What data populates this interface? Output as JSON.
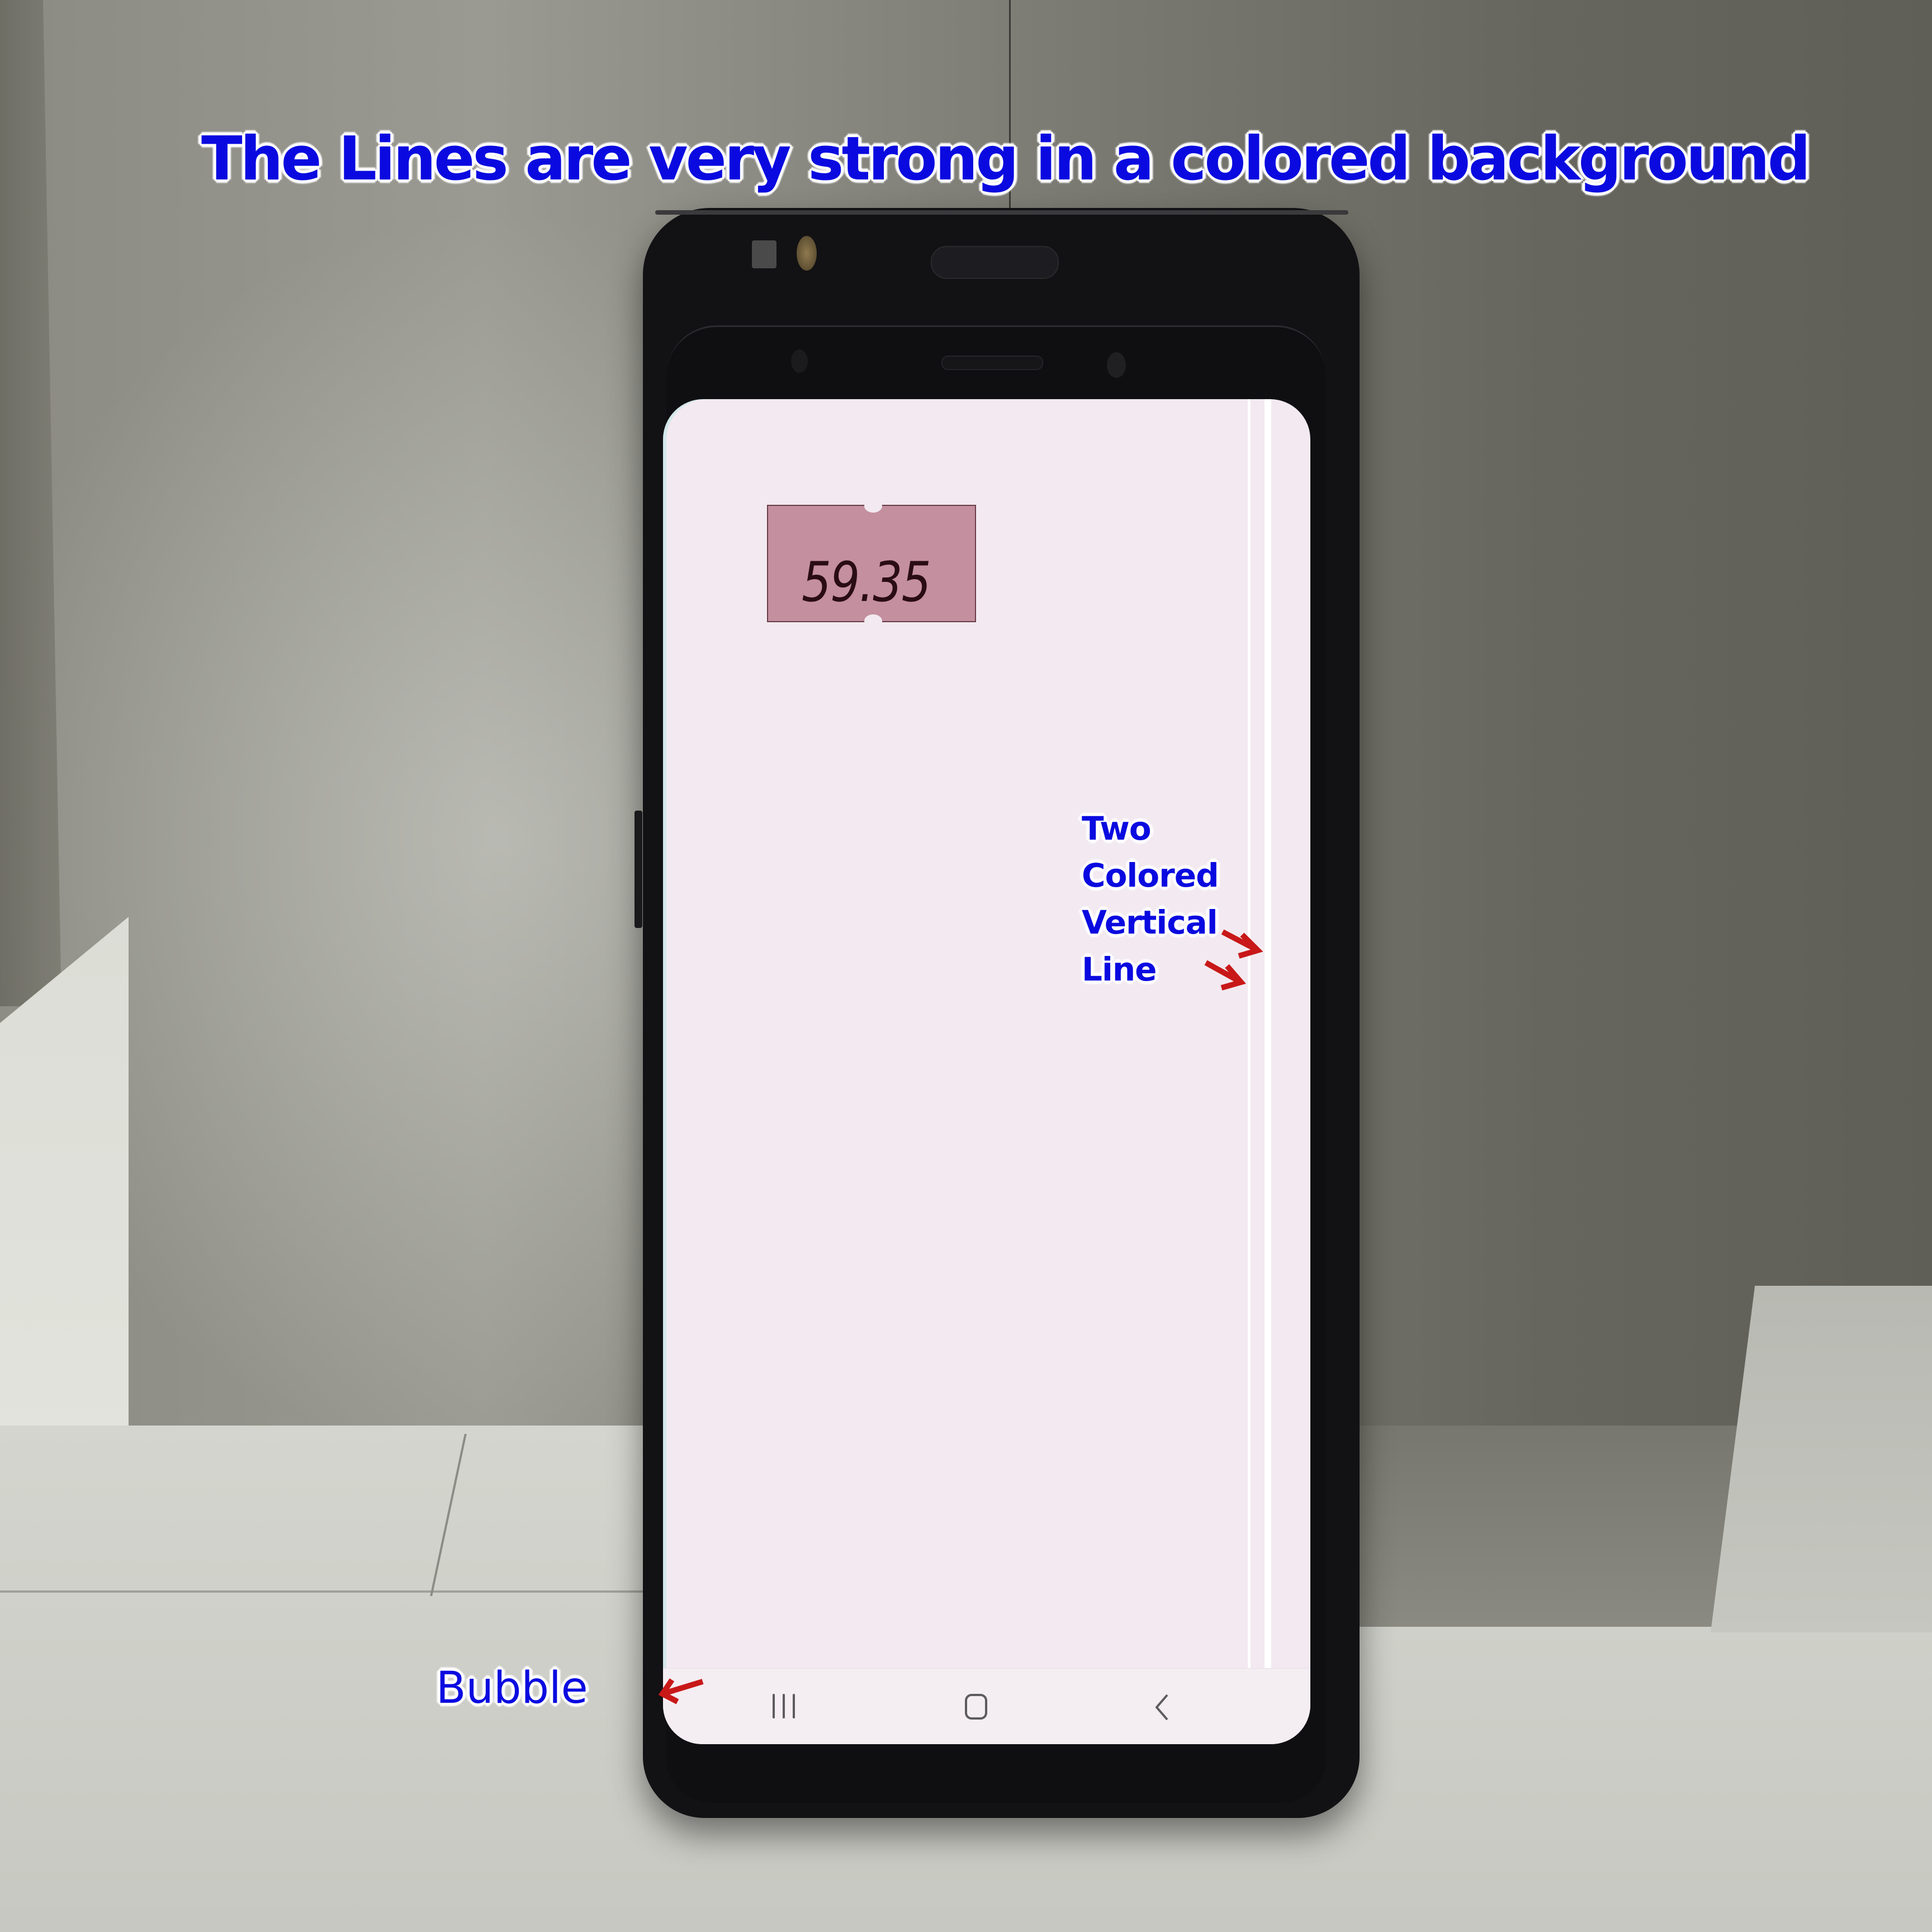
{
  "title": "The Lines are very strong in a colored background",
  "price_tag": {
    "text": "59.35",
    "color": "#c48f9f"
  },
  "annotations": {
    "lines_label": [
      "Two",
      "Colored",
      "Vertical",
      "Line"
    ],
    "bubble_label": "Bubble",
    "text_color": "#0a0ae0",
    "outline_color": "#ffffff",
    "arrow_color": "#c81818"
  },
  "phone": {
    "screen_color": "#f2eaf0",
    "nav_bar": {
      "icons": [
        "recents-icon",
        "home-icon",
        "back-icon"
      ]
    },
    "defect_lines": 2
  }
}
